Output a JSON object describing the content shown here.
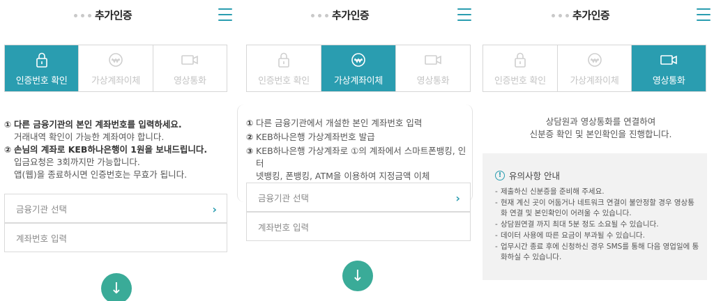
{
  "panels": [
    {
      "header": {
        "title": "추가인증"
      },
      "tabs": [
        {
          "label": "인증번호 확인",
          "icon": "lock-icon",
          "active": true
        },
        {
          "label": "가상계좌이체",
          "icon": "transfer-icon",
          "active": false
        },
        {
          "label": "영상통화",
          "icon": "video-camera-icon",
          "active": false
        }
      ],
      "instructions": {
        "item1_mark": "①",
        "item1_title": "다른 금융기관의 본인 계좌번호를 입력하세요.",
        "item1_sub": "거래내역 확인이 가능한 계좌여야 합니다.",
        "item2_mark": "②",
        "item2_title": "손님의 계좌로 KEB하나은행이 1원을 보내드립니다.",
        "item2_sub1": "입금요청은 3회까지만 가능합니다.",
        "item2_sub2": "앱(웹)을 종료하시면 인증번호는 무효가 됩니다."
      },
      "bank_select": {
        "label": "금융기관 선택",
        "chevron": "›"
      },
      "account_input": {
        "label": "계좌번호 입력"
      },
      "next_button": {
        "glyph": "↓"
      }
    },
    {
      "header": {
        "title": "추가인증"
      },
      "tabs": [
        {
          "label": "인증번호 확인",
          "icon": "lock-icon",
          "active": false
        },
        {
          "label": "가상계좌이체",
          "icon": "transfer-icon",
          "active": true
        },
        {
          "label": "영상통화",
          "icon": "video-camera-icon",
          "active": false
        }
      ],
      "instructions": {
        "item1_mark": "①",
        "item1_text": "다른 금융기관에서 개설한 본인 계좌번호 입력",
        "item2_mark": "②",
        "item2_text": "KEB하나은행 가상계좌번호 발급",
        "item3_mark": "③",
        "item3_line1": "KEB하나은행 가상계좌로 ①의 계좌에서 스마트폰뱅킹, 인터",
        "item3_line2": "넷뱅킹, 폰뱅킹, ATM을 이용하여 지정금액 이체"
      },
      "bank_select": {
        "label": "금융기관 선택",
        "chevron": "›"
      },
      "account_input": {
        "label": "계좌번호 입력"
      },
      "next_button": {
        "glyph": "↓"
      }
    },
    {
      "header": {
        "title": "추가인증"
      },
      "tabs": [
        {
          "label": "인증번호 확인",
          "icon": "lock-icon",
          "active": false
        },
        {
          "label": "가상계좌이체",
          "icon": "transfer-icon",
          "active": false
        },
        {
          "label": "영상통화",
          "icon": "video-camera-icon",
          "active": true
        }
      ],
      "intro": {
        "line1": "상담원과 영상통화를 연결하여",
        "line2": "신분증 확인 및 본인확인을 진행합니다."
      },
      "notice": {
        "icon_glyph": "!",
        "title": "유의사항 안내",
        "items": [
          "제출하신 신분증을 준비해 주세요.",
          "현재 계신 곳이 어둡거나 네트워크 연결이 불안정할 경우 영상통화 연결 및 본인확인이 어려울 수 있습니다.",
          "상담원연결 까지 최대 5분 정도 소요될 수 있습니다.",
          "데이터 사용에 따른 요금이 부과될 수 있습니다.",
          "업무시간 종료 후에 신청하신 경우 SMS를 통해 다음 영업일에 통화하실 수 있습니다."
        ]
      }
    }
  ],
  "colors": {
    "accent": "#2a9db0",
    "next_button": "#3aab98",
    "inactive_text": "#c4c4c4"
  }
}
